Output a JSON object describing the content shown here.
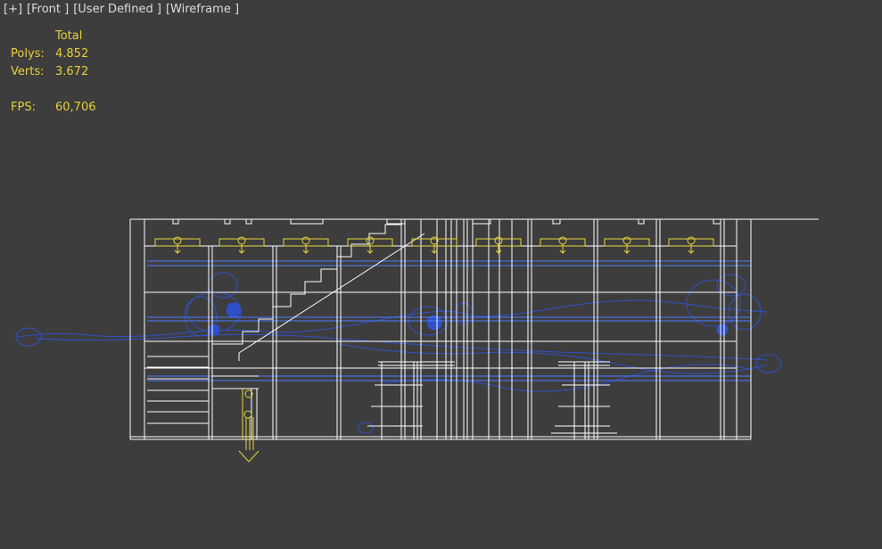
{
  "viewport": {
    "menu_label": "[+]",
    "view_label": "[Front ]",
    "shading_mode_label": "[User Defined ]",
    "display_mode_label": "[Wireframe ]"
  },
  "stats": {
    "column_header": "Total",
    "polys_label": "Polys:",
    "polys_value": "4.852",
    "verts_label": "Verts:",
    "verts_value": "3.672",
    "fps_label": "FPS:",
    "fps_value": "60,706"
  },
  "colors": {
    "background": "#3d3d3d",
    "stats_text": "#e9cf3c",
    "label_text": "#dcdcdc",
    "geometry_white": "#ffffff",
    "light_yellow": "#e6d83a",
    "helper_blue": "#2f50c8",
    "guide_blue": "#4f7cff"
  }
}
